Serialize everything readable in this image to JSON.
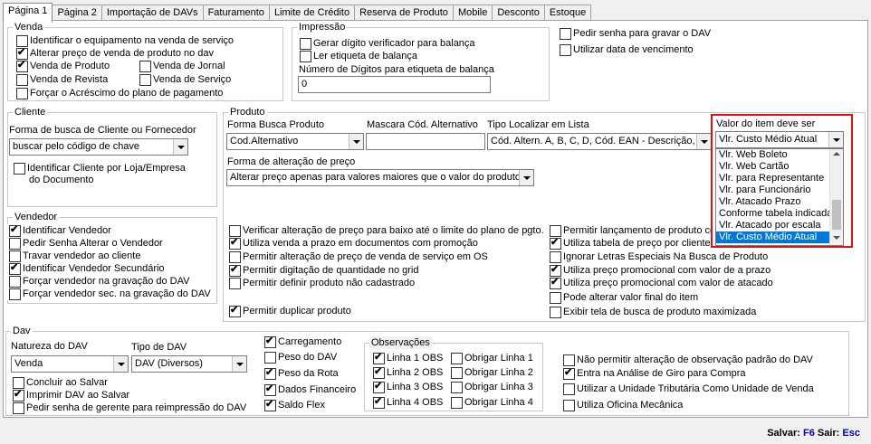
{
  "tabs": [
    "Página 1",
    "Página 2",
    "Importação de DAVs",
    "Faturamento",
    "Limite de Crédito",
    "Reserva de Produto",
    "Mobile",
    "Desconto",
    "Estoque"
  ],
  "venda": {
    "title": "Venda",
    "identificar_equip": "Identificar o equipamento na venda de serviço",
    "alterar_preco": "Alterar preço de venda de produto no dav",
    "venda_produto": "Venda de Produto",
    "venda_jornal": "Venda de Jornal",
    "venda_revista": "Venda de Revista",
    "venda_servico": "Venda de Serviço",
    "forcar_acrescimo": "Forçar o Acréscimo do plano de pagamento"
  },
  "impressao": {
    "title": "Impressão",
    "gerar_digito": "Gerar dígito verificador para balança",
    "ler_etiqueta": "Ler etiqueta de balança",
    "num_digitos_label": "Número de Dígitos para etiqueta de balança",
    "num_digitos_value": "0"
  },
  "top_right": {
    "pedir_senha_gravar": "Pedir senha para gravar o DAV",
    "utilizar_data_venc": "Utilizar data de vencimento"
  },
  "cliente": {
    "title": "Cliente",
    "forma_busca_label": "Forma de busca de Cliente ou Fornecedor",
    "forma_busca_value": "buscar pelo código de chave",
    "identificar_loja": "Identificar Cliente por Loja/Empresa",
    "identificar_loja2": "do Documento"
  },
  "produto": {
    "title": "Produto",
    "forma_busca_label": "Forma Busca Produto",
    "forma_busca_value": "Cod.Alternativo",
    "mascara_label": "Mascara Cód. Alternativo",
    "tipo_localizar_label": "Tipo Localizar em Lista",
    "tipo_localizar_value": "Cód. Altern. A, B, C, D, Cód. EAN - Descrição, ",
    "valor_item_label": "Valor do item deve ser",
    "valor_item_value": "Vlr. Custo Médio Atual",
    "valor_item_options": [
      "Vlr. Web Boleto",
      "Vlr. Web Cartão",
      "Vlr. para Representante",
      "Vlr. para Funcionário",
      "Vlr. Atacado Prazo",
      "Conforme tabela indicada",
      "Vlr. Atacado por escala",
      "Vlr. Custo Médio Atual"
    ],
    "forma_alteracao_label": "Forma de alteração de preço",
    "forma_alteracao_value": "Alterar preço apenas para valores maiores que o valor do produto",
    "left_checks": [
      "Verificar alteração de preço para baixo até o limite do plano de pgto.",
      "Utiliza venda a prazo em documentos com promoção",
      "Permitir alteração de preço de venda  de serviço em OS",
      "Permitir digitação de quantidade no grid",
      "Permitir definir produto não cadastrado"
    ],
    "permitir_duplicar": "Permitir duplicar produto",
    "right_checks": [
      "Permitir lançamento de produto com",
      "Utiliza tabela de preço por cliente",
      "Ignorar Letras Especiais Na Busca de Produto",
      "Utiliza preço promocional com valor de a prazo",
      "Utiliza preço promocional com valor de atacado",
      "Pode alterar valor final do item",
      "Exibir tela de busca de produto maximizada"
    ]
  },
  "vendedor": {
    "title": "Vendedor",
    "items": [
      "Identificar Vendedor",
      "Pedir Senha Alterar o Vendedor",
      "Travar vendedor ao cliente",
      "Identificar Vendedor Secundário",
      "Forçar vendedor na gravação do DAV",
      "Forçar vendedor sec. na gravação do DAV"
    ]
  },
  "dav": {
    "title": "Dav",
    "natureza_label": "Natureza do DAV",
    "natureza_value": "Venda",
    "tipo_label": "Tipo de DAV",
    "tipo_value": "DAV (Diversos)",
    "concluir": "Concluir ao Salvar",
    "imprimir": "Imprimir DAV ao Salvar",
    "pedir_senha_gerente": "Pedir senha de gerente para reimpressão do DAV",
    "middle": [
      "Carregamento",
      "Peso do DAV",
      "Peso da Rota",
      "Dados Financeiro",
      "Saldo Flex"
    ],
    "obs_title": "Observações",
    "obs_linhas": [
      "Linha 1 OBS",
      "Linha 2 OBS",
      "Linha 3 OBS",
      "Linha 4 OBS"
    ],
    "obrigar": [
      "Obrigar Linha 1",
      "Obrigar Linha 2",
      "Obrigar Linha 3",
      "Obrigar Linha 4"
    ],
    "right": [
      "Não permitir alteração de observação padrão do DAV",
      "Entra na Análise de Giro para Compra",
      "Utilizar a Unidade Tributária Como Unidade de Venda",
      "Utiliza Oficina Mecânica"
    ]
  },
  "footer": {
    "salvar": "Salvar:",
    "f6": "F6",
    "sair": "Sair:",
    "esc": "Esc"
  },
  "colors": {
    "accent": "#0078d7",
    "highlight_border": "#e01010",
    "shortcut": "#0000c0"
  }
}
